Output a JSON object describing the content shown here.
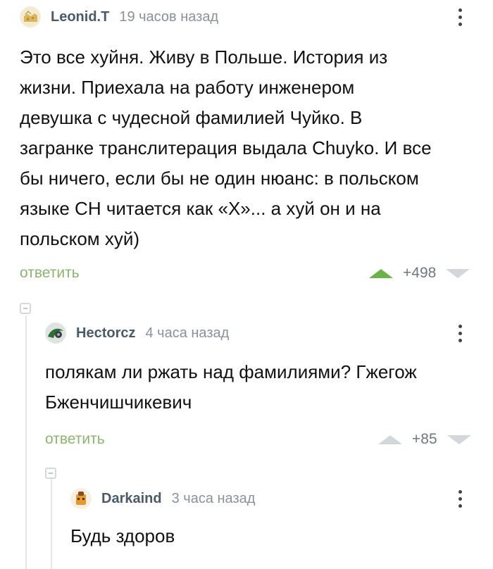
{
  "comments": [
    {
      "author": "Leonid.T",
      "time": "19 часов назад",
      "text_lines": [
        "Это все хуйня. Живу в Польше. История из",
        "жизни. Приехала на работу инженером",
        "девушка с чудесной фамилией Чуйко. В",
        "загранке транслитерация выдала Chuyko. И все",
        "бы ничего, если бы не один нюанс: в польском",
        "языке CH читается как «X»... а хуй он и на",
        "польском хуй)"
      ],
      "reply_label": "ответить",
      "score": "+498"
    },
    {
      "author": "Hectorcz",
      "time": "4 часа назад",
      "text_lines": [
        "полякам ли ржать над фамилиями? Гжегож",
        "Бженчишчикевич"
      ],
      "reply_label": "ответить",
      "score": "+85"
    },
    {
      "author": "Darkaind",
      "time": "3 часа назад",
      "text_lines": [
        "Будь здоров"
      ]
    }
  ],
  "colors": {
    "accent_green": "#8ab56a",
    "upvote_active": "#6bb24c",
    "vote_inactive": "#d3d6da"
  }
}
